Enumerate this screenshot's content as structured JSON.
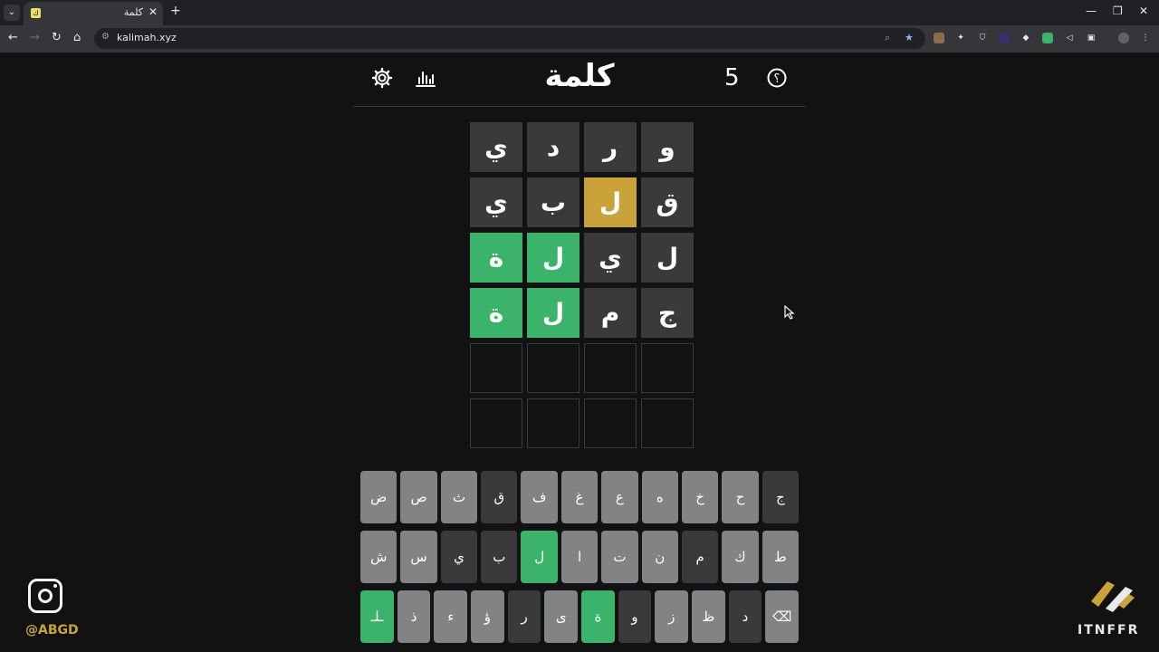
{
  "browser": {
    "tab_title": "كلمة",
    "tab_favicon": "ك",
    "url": "kalimah.xyz"
  },
  "app": {
    "title": "كلمة",
    "count": "5",
    "icons": [
      "help-icon",
      "stats-icon",
      "settings-icon"
    ]
  },
  "grid": [
    [
      {
        "l": "و",
        "s": "absent"
      },
      {
        "l": "ر",
        "s": "absent"
      },
      {
        "l": "د",
        "s": "absent"
      },
      {
        "l": "ي",
        "s": "absent"
      }
    ],
    [
      {
        "l": "ق",
        "s": "absent"
      },
      {
        "l": "ل",
        "s": "present"
      },
      {
        "l": "ب",
        "s": "absent"
      },
      {
        "l": "ي",
        "s": "absent"
      }
    ],
    [
      {
        "l": "ل",
        "s": "absent"
      },
      {
        "l": "ي",
        "s": "absent"
      },
      {
        "l": "ل",
        "s": "correct"
      },
      {
        "l": "ة",
        "s": "correct"
      }
    ],
    [
      {
        "l": "ج",
        "s": "absent"
      },
      {
        "l": "م",
        "s": "absent"
      },
      {
        "l": "ل",
        "s": "correct"
      },
      {
        "l": "ة",
        "s": "correct"
      }
    ],
    [
      {
        "l": "",
        "s": "empty"
      },
      {
        "l": "",
        "s": "empty"
      },
      {
        "l": "",
        "s": "empty"
      },
      {
        "l": "",
        "s": "empty"
      }
    ],
    [
      {
        "l": "",
        "s": "empty"
      },
      {
        "l": "",
        "s": "empty"
      },
      {
        "l": "",
        "s": "empty"
      },
      {
        "l": "",
        "s": "empty"
      }
    ]
  ],
  "keyboard": [
    [
      {
        "l": "ج",
        "s": "absent"
      },
      {
        "l": "ح",
        "s": ""
      },
      {
        "l": "خ",
        "s": ""
      },
      {
        "l": "ه",
        "s": ""
      },
      {
        "l": "ع",
        "s": ""
      },
      {
        "l": "غ",
        "s": ""
      },
      {
        "l": "ف",
        "s": ""
      },
      {
        "l": "ق",
        "s": "absent"
      },
      {
        "l": "ث",
        "s": ""
      },
      {
        "l": "ص",
        "s": ""
      },
      {
        "l": "ض",
        "s": ""
      }
    ],
    [
      {
        "l": "ط",
        "s": ""
      },
      {
        "l": "ك",
        "s": ""
      },
      {
        "l": "م",
        "s": "absent"
      },
      {
        "l": "ن",
        "s": ""
      },
      {
        "l": "ت",
        "s": ""
      },
      {
        "l": "ا",
        "s": ""
      },
      {
        "l": "ل",
        "s": "correct"
      },
      {
        "l": "ب",
        "s": "absent"
      },
      {
        "l": "ي",
        "s": "absent"
      },
      {
        "l": "س",
        "s": ""
      },
      {
        "l": "ش",
        "s": ""
      }
    ],
    [
      {
        "l": "⌫",
        "s": "",
        "w": "wide",
        "n": "backspace-key"
      },
      {
        "l": "د",
        "s": "absent"
      },
      {
        "l": "ظ",
        "s": ""
      },
      {
        "l": "ز",
        "s": ""
      },
      {
        "l": "و",
        "s": "absent"
      },
      {
        "l": "ة",
        "s": "correct"
      },
      {
        "l": "ى",
        "s": ""
      },
      {
        "l": "ر",
        "s": "absent"
      },
      {
        "l": "ؤ",
        "s": ""
      },
      {
        "l": "ء",
        "s": ""
      },
      {
        "l": "ذ",
        "s": ""
      },
      {
        "l": "ـلـ",
        "s": "correct",
        "w": "wide",
        "n": "enter-key"
      }
    ]
  ],
  "overlay": {
    "handle": "@ABGD",
    "brand": "ITNFFR"
  }
}
